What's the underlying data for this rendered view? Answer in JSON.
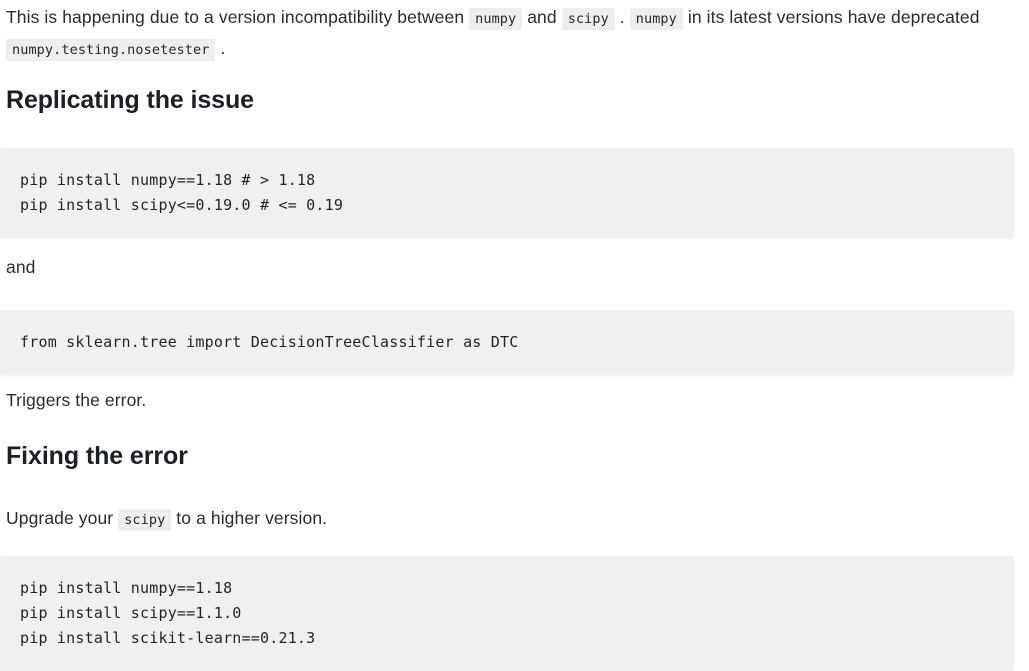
{
  "document": {
    "intro": {
      "segments": [
        {
          "type": "text",
          "value": "This is happening due to a version incompatibility between "
        },
        {
          "type": "code",
          "value": "numpy"
        },
        {
          "type": "text",
          "value": " and "
        },
        {
          "type": "code",
          "value": "scipy"
        },
        {
          "type": "text",
          "value": " . "
        },
        {
          "type": "code",
          "value": "numpy"
        },
        {
          "type": "text",
          "value": " in its latest versions have deprecated "
        },
        {
          "type": "code",
          "value": "numpy.testing.nosetester"
        },
        {
          "type": "text",
          "value": " ."
        }
      ],
      "text_1": "This is happening due to a version incompatibility between ",
      "code_numpy_1": "numpy",
      "text_2": " and ",
      "code_scipy": "scipy",
      "text_3": " . ",
      "code_numpy_2": "numpy",
      "text_4": " in its latest versions have deprecated ",
      "code_nosetester": "numpy.testing.nosetester",
      "text_5": " ."
    },
    "heading_replicating": "Replicating the issue",
    "code_block_1": "pip install numpy==1.18 # > 1.18\npip install scipy<=0.19.0 # <= 0.19",
    "paragraph_and": "and",
    "code_block_2": "from sklearn.tree import DecisionTreeClassifier as DTC",
    "paragraph_triggers": "Triggers the error.",
    "heading_fixing": "Fixing the error",
    "upgrade": {
      "text_1": "Upgrade your ",
      "code_scipy": "scipy",
      "text_2": " to a higher version."
    },
    "code_block_3": "pip install numpy==1.18\npip install scipy==1.1.0\npip install scikit-learn==0.21.3"
  },
  "colors": {
    "page_background": "#ffffff",
    "body_text": "#2b2b2b",
    "heading_text": "#1b1f26",
    "inline_code_background": "#eeeeee",
    "code_block_background": "#f0f0f0",
    "code_text": "#1f2328"
  }
}
